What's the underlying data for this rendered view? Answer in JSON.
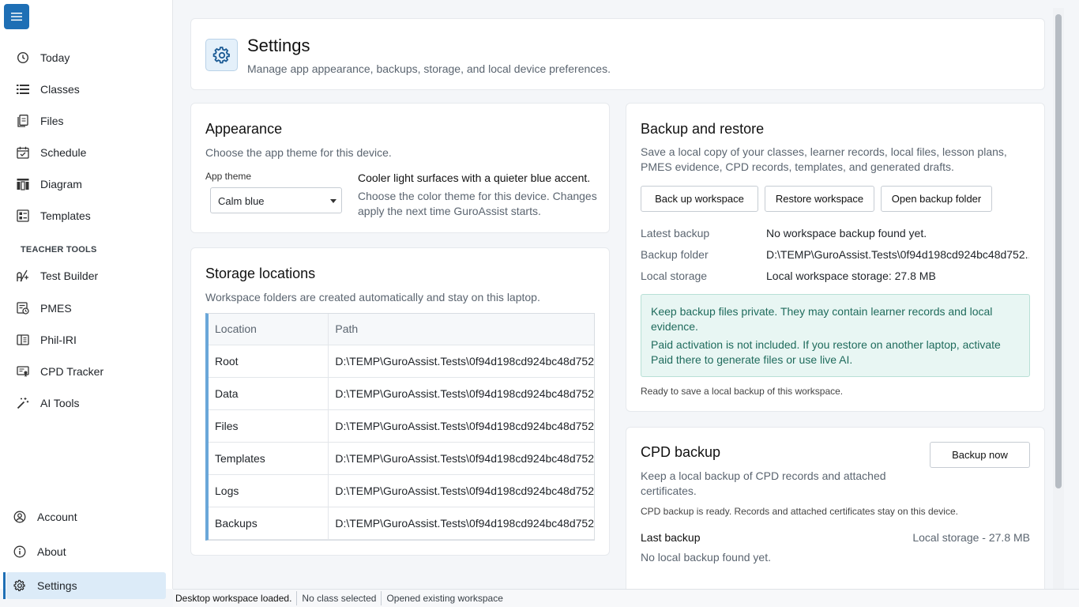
{
  "sidebar": {
    "menu_icon": "hamburger-icon",
    "items": [
      {
        "label": "Today",
        "icon": "clock-icon"
      },
      {
        "label": "Classes",
        "icon": "list-icon"
      },
      {
        "label": "Files",
        "icon": "document-icon"
      },
      {
        "label": "Schedule",
        "icon": "calendar-icon"
      },
      {
        "label": "Diagram",
        "icon": "columns-icon"
      },
      {
        "label": "Templates",
        "icon": "template-icon"
      }
    ],
    "section_title": "TEACHER TOOLS",
    "tools": [
      {
        "label": "Test Builder",
        "icon": "test-builder-icon"
      },
      {
        "label": "PMES",
        "icon": "pmes-icon"
      },
      {
        "label": "Phil-IRI",
        "icon": "book-icon"
      },
      {
        "label": "CPD Tracker",
        "icon": "certificate-icon"
      },
      {
        "label": "AI Tools",
        "icon": "magic-wand-icon"
      }
    ],
    "bottom": [
      {
        "label": "Account",
        "icon": "user-icon"
      },
      {
        "label": "About",
        "icon": "info-icon"
      },
      {
        "label": "Settings",
        "icon": "gear-icon"
      }
    ]
  },
  "header": {
    "title": "Settings",
    "subtitle": "Manage app appearance, backups, storage, and local device preferences."
  },
  "appearance": {
    "title": "Appearance",
    "subtitle": "Choose the app theme for this device.",
    "theme_label": "App theme",
    "theme_value": "Calm blue",
    "theme_desc": "Cooler light surfaces with a quieter blue accent.",
    "theme_note": "Choose the color theme for this device. Changes apply the next time GuroAssist starts."
  },
  "storage": {
    "title": "Storage locations",
    "subtitle": "Workspace folders are created automatically and stay on this laptop.",
    "col_location": "Location",
    "col_path": "Path",
    "rows": [
      {
        "location": "Root",
        "path": "D:\\TEMP\\GuroAssist.Tests\\0f94d198cd924bc48d752"
      },
      {
        "location": "Data",
        "path": "D:\\TEMP\\GuroAssist.Tests\\0f94d198cd924bc48d752"
      },
      {
        "location": "Files",
        "path": "D:\\TEMP\\GuroAssist.Tests\\0f94d198cd924bc48d752"
      },
      {
        "location": "Templates",
        "path": "D:\\TEMP\\GuroAssist.Tests\\0f94d198cd924bc48d752"
      },
      {
        "location": "Logs",
        "path": "D:\\TEMP\\GuroAssist.Tests\\0f94d198cd924bc48d752"
      },
      {
        "location": "Backups",
        "path": "D:\\TEMP\\GuroAssist.Tests\\0f94d198cd924bc48d752"
      }
    ]
  },
  "backup": {
    "title": "Backup and restore",
    "subtitle": "Save a local copy of your classes, learner records, local files, lesson plans, PMES evidence, CPD records, templates, and generated drafts.",
    "btn_backup": "Back up workspace",
    "btn_restore": "Restore workspace",
    "btn_open": "Open backup folder",
    "latest_label": "Latest backup",
    "latest_value": "No workspace backup found yet.",
    "folder_label": "Backup folder",
    "folder_value": "D:\\TEMP\\GuroAssist.Tests\\0f94d198cd924bc48d752...",
    "storage_label": "Local storage",
    "storage_value": "Local workspace storage: 27.8 MB",
    "notice_1": "Keep backup files private. They may contain learner records and local evidence.",
    "notice_2": "Paid activation is not included. If you restore on another laptop, activate Paid there to generate files or use live AI.",
    "ready": "Ready to save a local backup of this workspace."
  },
  "cpd": {
    "title": "CPD backup",
    "subtitle": "Keep a local backup of CPD records and attached certificates.",
    "btn": "Backup now",
    "ready": "CPD backup is ready. Records and attached certificates stay on this device.",
    "last_label": "Last backup",
    "last_value": "No local backup found yet.",
    "storage": "Local storage - 27.8 MB"
  },
  "statusbar": {
    "s1": "Desktop workspace loaded.",
    "s2": "No class selected",
    "s3": "Opened existing workspace"
  },
  "colors": {
    "accent": "#1e6fb5",
    "notice_bg": "#e8f6f3",
    "notice_text": "#1f6b5c"
  }
}
